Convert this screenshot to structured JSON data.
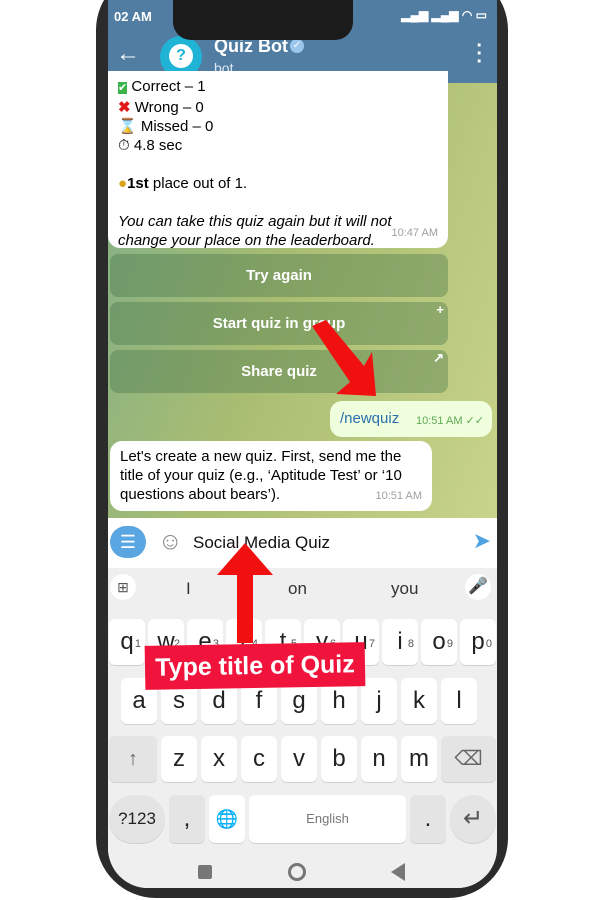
{
  "status": {
    "time": "02 AM"
  },
  "header": {
    "title": "Quiz Bot",
    "subtitle": "bot",
    "back_icon": "arrow-left-icon",
    "menu_icon": "more-vertical-icon",
    "verified_icon": "verified-badge-icon"
  },
  "results": {
    "correct": "Correct – 1",
    "wrong": "Wrong – 0",
    "missed": "Missed – 0",
    "time": "4.8 sec",
    "place_bold": "1st",
    "place_rest": " place out of 1.",
    "note": "You can take this quiz again but it will not change your place on the leaderboard.",
    "timestamp": "10:47 AM"
  },
  "inline_buttons": [
    {
      "label": "Try again"
    },
    {
      "label": "Start quiz in group",
      "corner": "+"
    },
    {
      "label": "Share quiz",
      "corner": "↗"
    }
  ],
  "outgoing": {
    "text": "/newquiz",
    "timestamp": "10:51 AM"
  },
  "incoming": {
    "text": "Let's create a new quiz. First, send me the title of your quiz (e.g., ‘Aptitude Test’ or ‘10 questions about bears’).",
    "timestamp": "10:51 AM"
  },
  "input": {
    "value": "Social Media Quiz"
  },
  "suggestions": [
    "I",
    "on",
    "you"
  ],
  "keyboard": {
    "row1": [
      "q",
      "w",
      "e",
      "r",
      "t",
      "y",
      "u",
      "i",
      "o",
      "p"
    ],
    "row1_nums": [
      "1",
      "2",
      "3",
      "4",
      "5",
      "6",
      "7",
      "8",
      "9",
      "0"
    ],
    "row2": [
      "a",
      "s",
      "d",
      "f",
      "g",
      "h",
      "j",
      "k",
      "l"
    ],
    "row3": [
      "z",
      "x",
      "c",
      "v",
      "b",
      "n",
      "m"
    ],
    "symbols": "?123",
    "comma": ",",
    "space": "English",
    "period": "."
  },
  "annotation": {
    "label": "Type title of Quiz"
  },
  "colors": {
    "header": "#517da2",
    "accent": "#f0143c",
    "outgoing_bubble": "#effedd",
    "send": "#4fa3e0"
  }
}
